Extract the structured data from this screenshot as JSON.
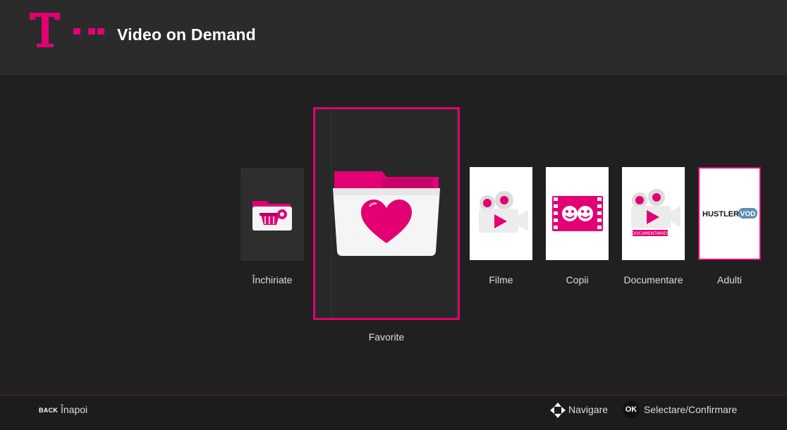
{
  "header": {
    "title": "Video on Demand",
    "logo_icon": "telekom-t-logo",
    "brand_color": "#e20074"
  },
  "categories": [
    {
      "id": "rented",
      "label": "Închiriate",
      "icon": "basket-folder-icon",
      "selected": false
    },
    {
      "id": "favorite",
      "label": "Favorite",
      "icon": "heart-folder-icon",
      "selected": true
    },
    {
      "id": "movies",
      "label": "Filme",
      "icon": "video-camera-icon",
      "selected": false
    },
    {
      "id": "kids",
      "label": "Copii",
      "icon": "kids-film-icon",
      "selected": false
    },
    {
      "id": "docs",
      "label": "Documentare",
      "icon": "documentary-camera-icon",
      "selected": false,
      "icon_caption": "DOCUMENTARIES"
    },
    {
      "id": "adult",
      "label": "Adulti",
      "icon": "hustler-vod-logo",
      "selected": false,
      "logo_text": "HUSTLER",
      "logo_badge": "VOD"
    }
  ],
  "footer": {
    "back_key": "BACK",
    "back_label": "Înapoi",
    "nav_icon": "directional-arrows-icon",
    "nav_label": "Navigare",
    "ok_key": "OK",
    "ok_label": "Selectare/Confirmare"
  }
}
